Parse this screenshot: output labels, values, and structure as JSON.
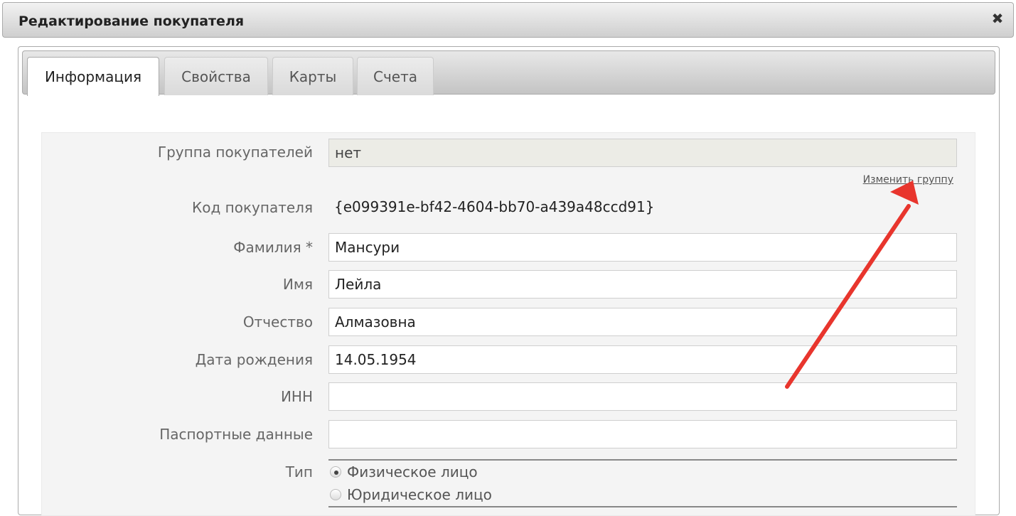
{
  "dialog": {
    "title": "Редактирование покупателя",
    "close_icon": "close-icon"
  },
  "tabs": [
    {
      "label": "Информация",
      "active": true
    },
    {
      "label": "Свойства",
      "active": false
    },
    {
      "label": "Карты",
      "active": false
    },
    {
      "label": "Счета",
      "active": false
    }
  ],
  "form": {
    "group": {
      "label": "Группа покупателей",
      "value": "нет"
    },
    "change_group_link": "Изменить группу",
    "code": {
      "label": "Код покупателя",
      "value": "{e099391e-bf42-4604-bb70-a439a48ccd91}"
    },
    "last_name": {
      "label": "Фамилия *",
      "value": "Мансури"
    },
    "first_name": {
      "label": "Имя",
      "value": "Лейла"
    },
    "patronymic": {
      "label": "Отчество",
      "value": "Алмазовна"
    },
    "birth_date": {
      "label": "Дата рождения",
      "value": "14.05.1954"
    },
    "inn": {
      "label": "ИНН",
      "value": ""
    },
    "passport": {
      "label": "Паспортные данные",
      "value": ""
    },
    "type": {
      "label": "Тип",
      "options": [
        {
          "label": "Физическое лицо",
          "checked": true
        },
        {
          "label": "Юридическое лицо",
          "checked": false
        }
      ]
    }
  },
  "colors": {
    "annotation_arrow": "#e8352d"
  }
}
